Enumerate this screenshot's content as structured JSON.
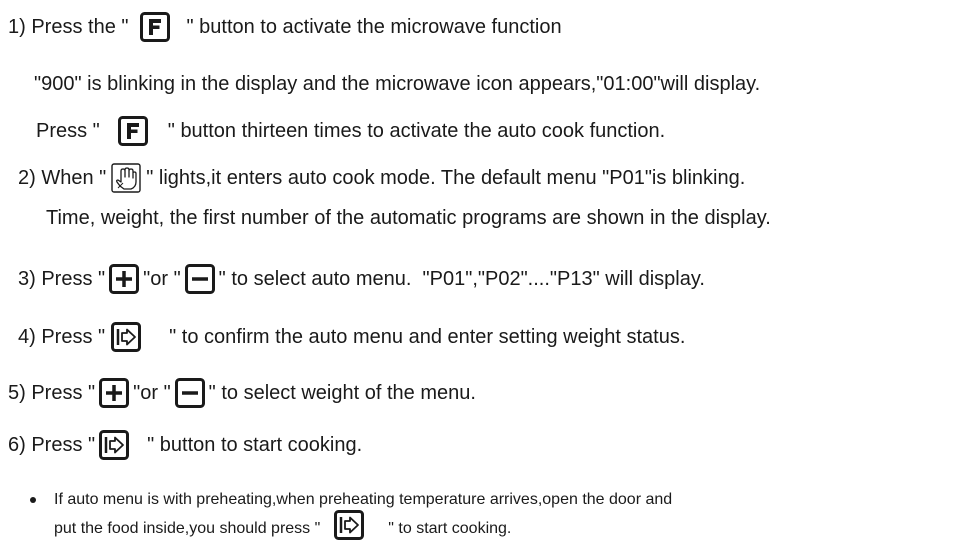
{
  "icons": {
    "function": "F-button-icon",
    "auto_cook": "auto-cook-hand-icon",
    "plus": "plus-button-icon",
    "minus": "minus-button-icon",
    "start": "start-confirm-button-icon"
  },
  "step1": {
    "a": "1) Press the \"",
    "b": "\" button to activate the microwave function"
  },
  "step1_detail": {
    "text": "\"900\" is blinking in the display and the microwave icon appears,\"01:00\"will display."
  },
  "step1_press": {
    "a": "Press \"",
    "b": "\" button thirteen times to activate the auto cook function."
  },
  "step2": {
    "a": "2) When \"",
    "b": "\" lights,it enters auto cook mode. The default menu \"P01\"is blinking."
  },
  "step2_detail": {
    "text": "Time, weight, the first number of the automatic programs are shown in the display."
  },
  "step3": {
    "a": "3) Press \"",
    "b": "\"or \"",
    "c": "\" to select auto menu.  \"P01\",\"P02\"....\"P13\" will display."
  },
  "step4": {
    "a": "4) Press \"",
    "b": "\" to confirm the auto menu and enter setting weight status."
  },
  "step5": {
    "a": "5) Press \"",
    "b": "\"or \"",
    "c": "\" to select weight of the menu."
  },
  "step6": {
    "a": "6) Press \"",
    "b": "\" button to start cooking."
  },
  "note": {
    "line1": "If auto menu is with preheating,when preheating temperature arrives,open the door and",
    "line2a": "put the food inside,you should press \"",
    "line2b": "\" to start cooking."
  }
}
